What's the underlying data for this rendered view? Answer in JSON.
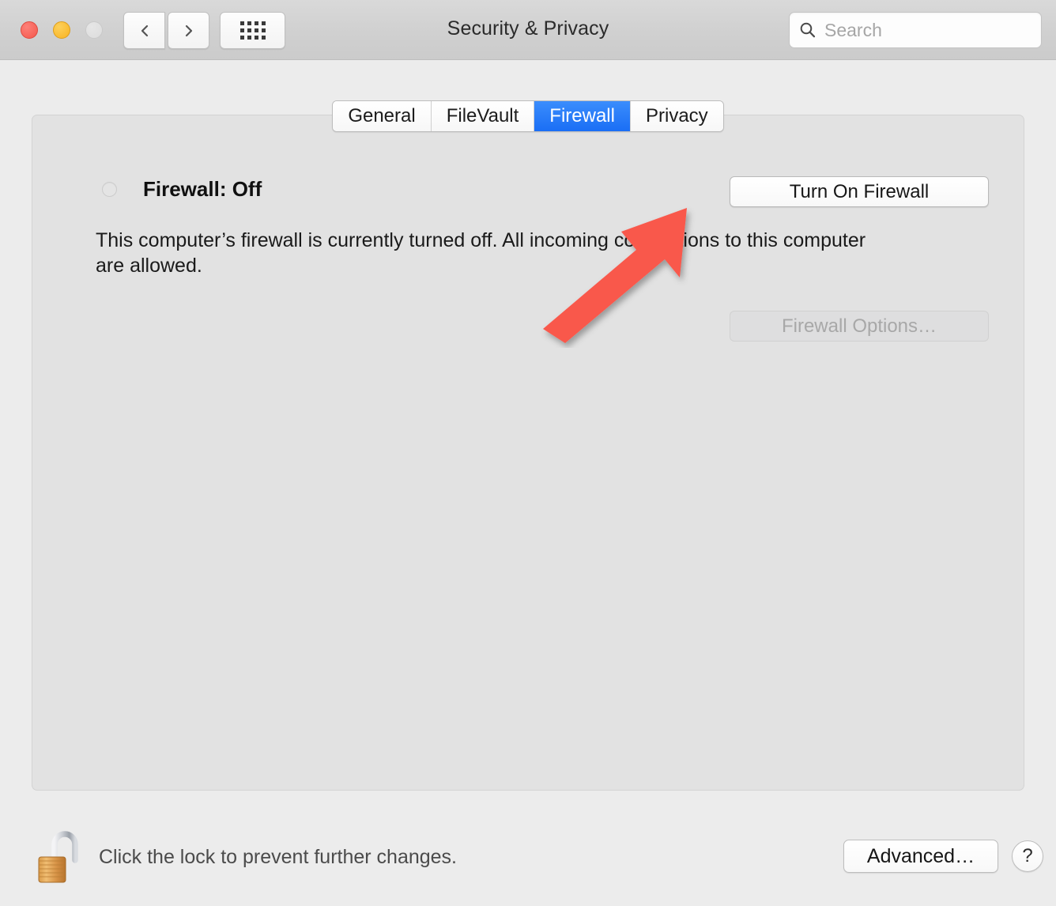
{
  "window": {
    "title": "Security & Privacy",
    "traffic_lights": {
      "close_label": "Close",
      "minimize_label": "Minimize",
      "zoom_label": "Zoom",
      "close_color": "#f4584c",
      "minimize_color": "#f8b322",
      "zoom_color": "#dcdcdc"
    }
  },
  "toolbar": {
    "back_label": "Back",
    "forward_label": "Forward",
    "show_all_label": "Show All",
    "search": {
      "value": "",
      "placeholder": "Search",
      "icon": "search-icon"
    }
  },
  "tabs": [
    {
      "label": "General",
      "active": false
    },
    {
      "label": "FileVault",
      "active": false
    },
    {
      "label": "Firewall",
      "active": true
    },
    {
      "label": "Privacy",
      "active": false
    }
  ],
  "main": {
    "status_label": "Firewall: Off",
    "status_state": "off",
    "description": "This computer’s firewall is currently turned off. All incoming connections to this computer are allowed.",
    "turn_on_button": "Turn On Firewall",
    "options_button": "Firewall Options…",
    "options_button_disabled": true
  },
  "annotation": {
    "type": "arrow",
    "color": "#f9584c",
    "points_to": "Turn On Firewall",
    "direction": "up-right"
  },
  "footer": {
    "lock_icon": "unlocked-padlock-icon",
    "lock_hint": "Click the lock to prevent further changes.",
    "advanced_button": "Advanced…",
    "help_button": "?"
  },
  "colors": {
    "toolbar_bg": "#d0d0d0",
    "window_bg": "#ececec",
    "panel_bg": "#e2e2e2",
    "tab_active_bg": "#1a6ef5",
    "annotation_red": "#f9584c",
    "lock_gold": "#d89a42"
  }
}
